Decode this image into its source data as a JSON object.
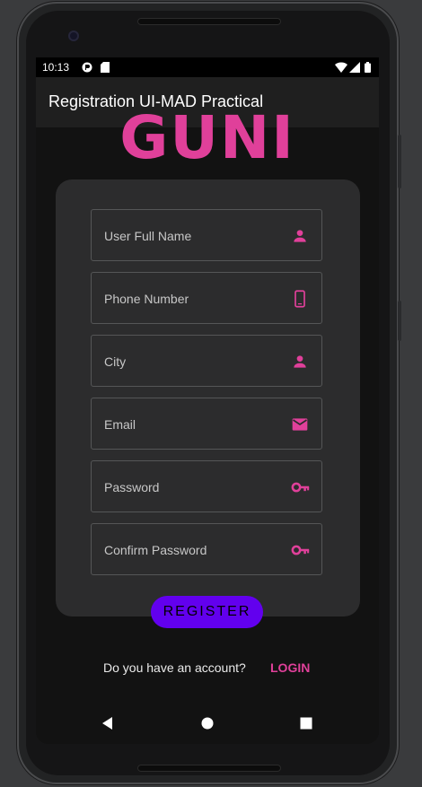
{
  "status_bar": {
    "time": "10:13"
  },
  "app_bar": {
    "title": "Registration UI-MAD Practical"
  },
  "logo": {
    "text": "GUNI"
  },
  "form": {
    "fields": [
      {
        "label": "User Full Name",
        "icon": "person-icon"
      },
      {
        "label": "Phone Number",
        "icon": "phone-icon"
      },
      {
        "label": "City",
        "icon": "person-icon"
      },
      {
        "label": "Email",
        "icon": "mail-icon"
      },
      {
        "label": "Password",
        "icon": "key-icon"
      },
      {
        "label": "Confirm Password",
        "icon": "key-icon"
      }
    ],
    "register_label": "REGISTER"
  },
  "footer": {
    "prompt": "Do you have an account?",
    "login_label": "LOGIN"
  },
  "colors": {
    "accent": "#e0409a",
    "button": "#6200ee",
    "background": "#121212",
    "card": "#2c2c2d"
  }
}
